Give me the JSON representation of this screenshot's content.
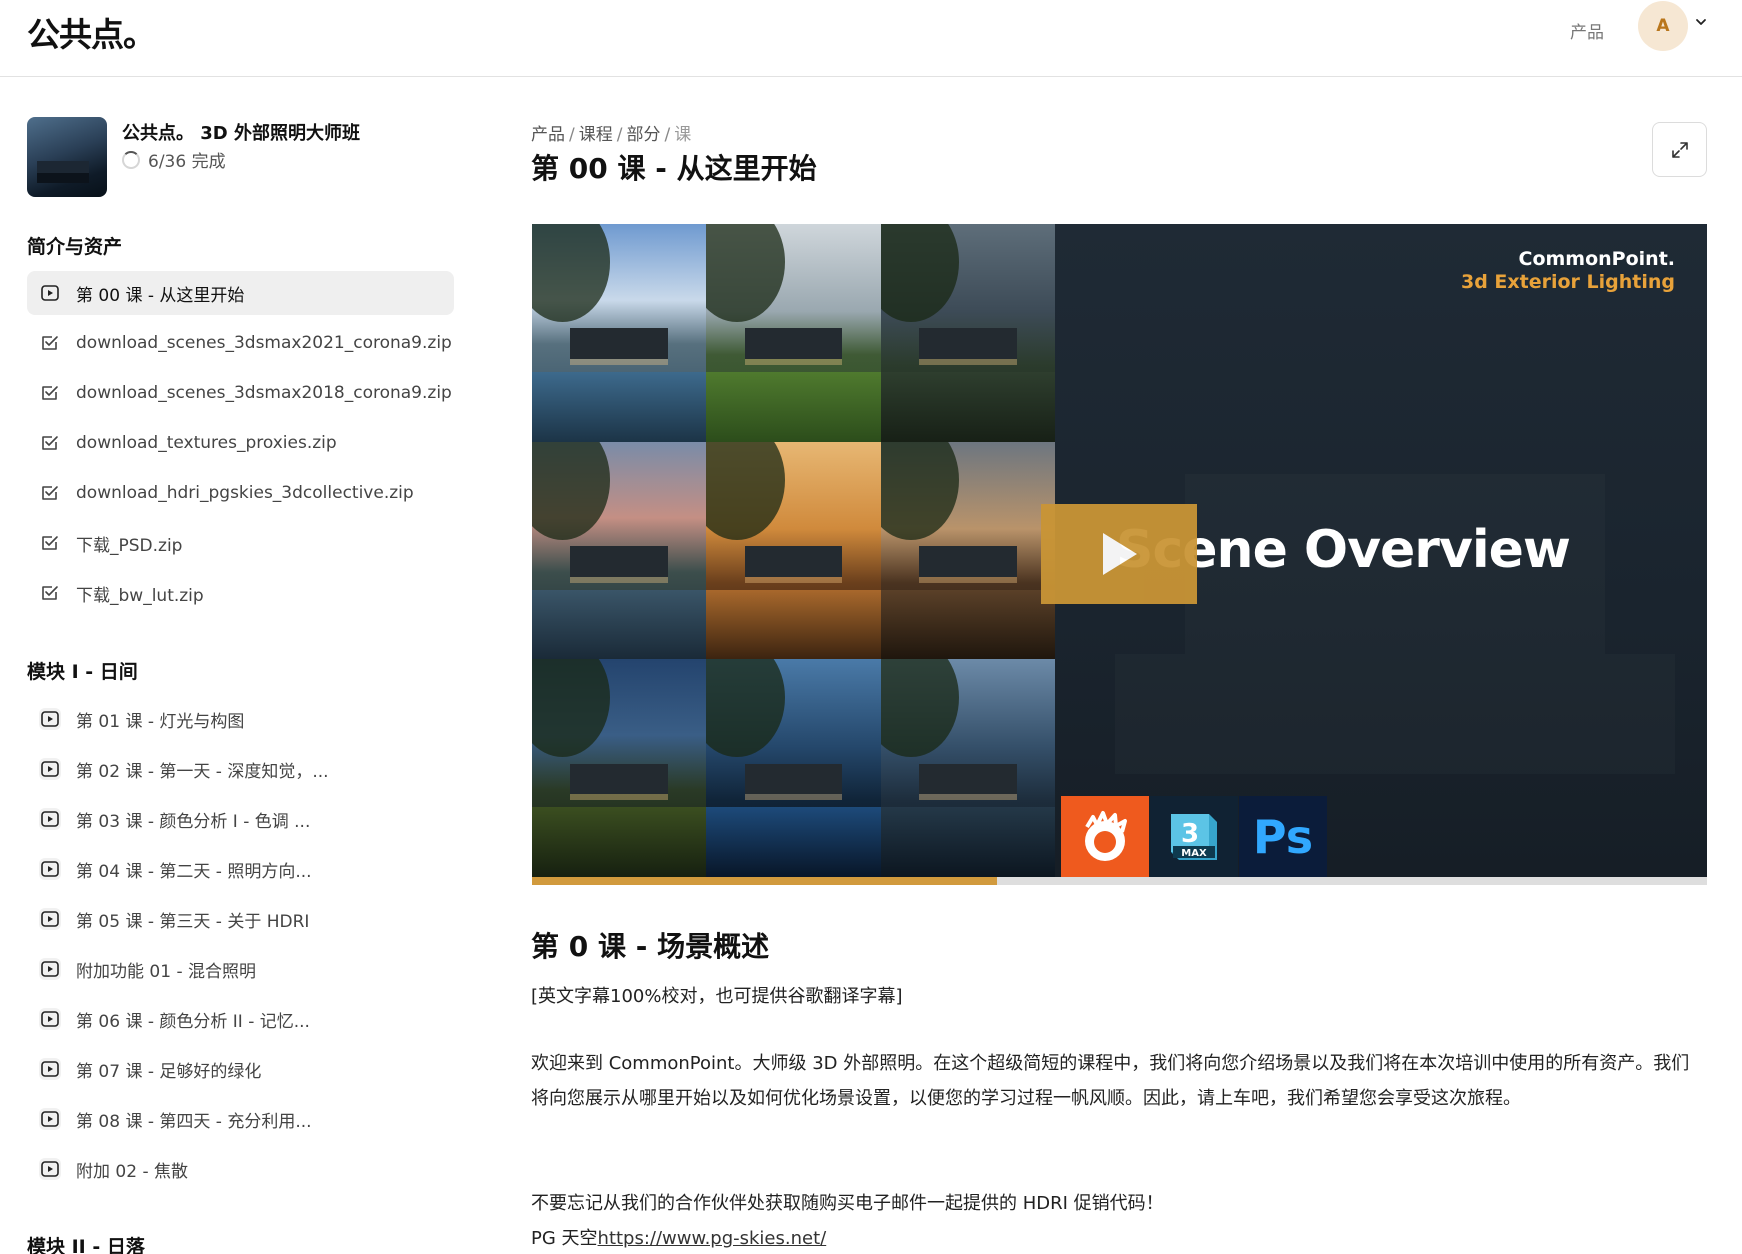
{
  "header": {
    "logo": "公共点。",
    "nav_products": "产品",
    "avatar_initial": "A"
  },
  "course": {
    "title": "公共点。 3D 外部照明大师班",
    "progress": "6/36 完成"
  },
  "sections": [
    {
      "title": "简介与资产",
      "items": [
        {
          "label": "第 00 课 - 从这里开始",
          "type": "video",
          "active": true
        },
        {
          "label": "download_scenes_3dsmax2021_corona9.zip",
          "type": "done"
        },
        {
          "label": "download_scenes_3dsmax2018_corona9.zip",
          "type": "done"
        },
        {
          "label": "download_textures_proxies.zip",
          "type": "done"
        },
        {
          "label": "download_hdri_pgskies_3dcollective.zip",
          "type": "done"
        },
        {
          "label": "下载_PSD.zip",
          "type": "done"
        },
        {
          "label": "下载_bw_lut.zip",
          "type": "done"
        }
      ]
    },
    {
      "title": "模块 I - 日间",
      "items": [
        {
          "label": "第 01 课 - 灯光与构图",
          "type": "video"
        },
        {
          "label": "第 02 课 - 第一天 - 深度知觉，...",
          "type": "video"
        },
        {
          "label": "第 03 课 - 颜色分析 I - 色调 ...",
          "type": "video"
        },
        {
          "label": "第 04 课 - 第二天 - 照明方向...",
          "type": "video"
        },
        {
          "label": "第 05 课 - 第三天 - 关于 HDRI",
          "type": "video"
        },
        {
          "label": "附加功能 01 - 混合照明",
          "type": "video"
        },
        {
          "label": "第 06 课 - 颜色分析 II - 记忆...",
          "type": "video"
        },
        {
          "label": "第 07 课 - 足够好的绿化",
          "type": "video"
        },
        {
          "label": "第 08 课 - 第四天 - 充分利用...",
          "type": "video"
        },
        {
          "label": "附加 02 - 焦散",
          "type": "video"
        }
      ]
    },
    {
      "title": "模块 II - 日落",
      "items": []
    }
  ],
  "breadcrumb": {
    "items": [
      "产品",
      "课程",
      "部分"
    ],
    "current": "课"
  },
  "page_title": "第 00 课 - 从这里开始",
  "video": {
    "brand_line1": "CommonPoint.",
    "brand_line2": "3d Exterior Lighting",
    "overlay_title": "Scene Overview",
    "progress": 0.396,
    "accent_color": "#d19a3d",
    "tools": [
      "corona-renderer-icon",
      "3ds-max-icon",
      "photoshop-icon"
    ],
    "max_number": "3",
    "max_label": "MAX",
    "ps_label": "Ps"
  },
  "content": {
    "heading": "第 0 课 - 场景概述",
    "note": "[英文字幕100%校对，也可提供谷歌翻译字幕]",
    "para1": "欢迎来到 CommonPoint。大师级 3D 外部照明。在这个超级简短的课程中，我们将向您介绍场景以及我们将在本次培训中使用的所有资产。我们将向您展示从哪里开始以及如何优化场景设置，以便您的学习过程一帆风顺。因此，请上车吧，我们希望您会享受这次旅程。",
    "para2": "不要忘记从我们的合作伙伴处获取随购买电子邮件一起提供的 HDRI 促销代码！",
    "para3_prefix": "PG 天空",
    "para3_link": "https://www.pg-skies.net/"
  }
}
